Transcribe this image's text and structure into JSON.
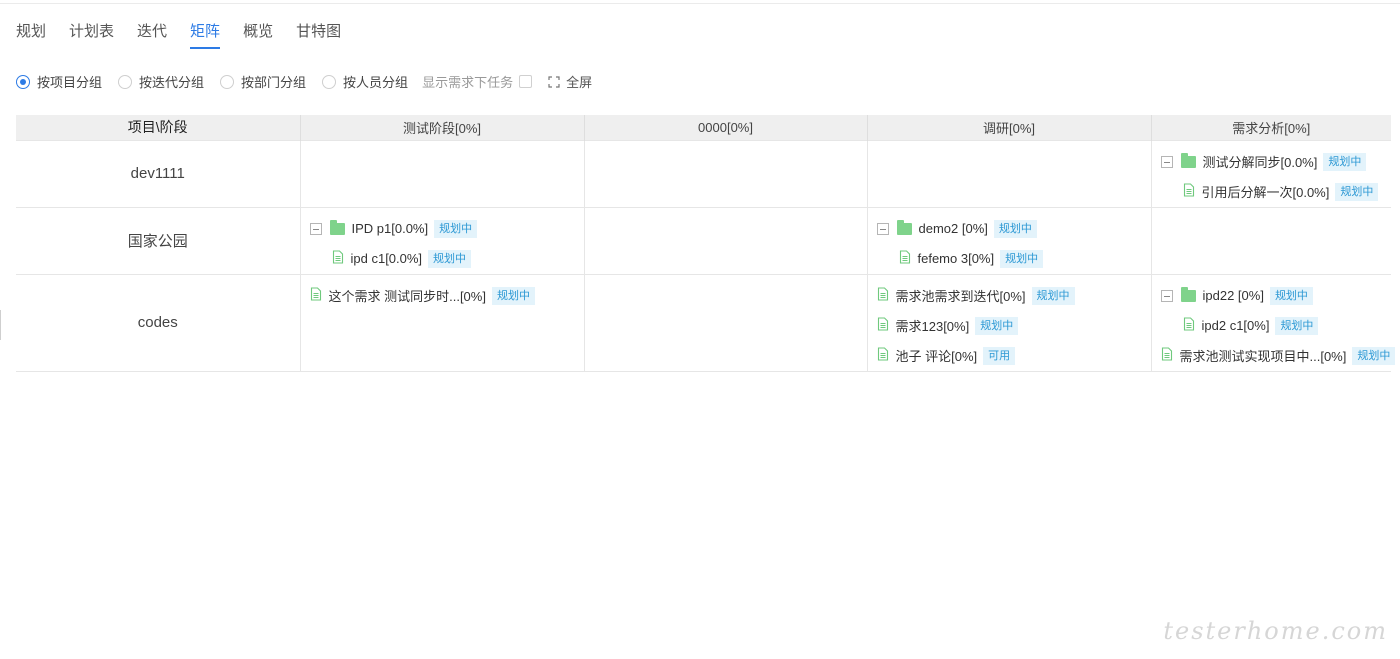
{
  "tabs": [
    {
      "label": "规划",
      "active": false
    },
    {
      "label": "计划表",
      "active": false
    },
    {
      "label": "迭代",
      "active": false
    },
    {
      "label": "矩阵",
      "active": true
    },
    {
      "label": "概览",
      "active": false
    },
    {
      "label": "甘特图",
      "active": false
    }
  ],
  "toolbar": {
    "group_options": [
      {
        "label": "按项目分组",
        "checked": true
      },
      {
        "label": "按迭代分组",
        "checked": false
      },
      {
        "label": "按部门分组",
        "checked": false
      },
      {
        "label": "按人员分组",
        "checked": false
      }
    ],
    "show_subtasks_label": "显示需求下任务",
    "fullscreen_label": "全屏"
  },
  "matrix": {
    "columns": [
      "项目\\阶段",
      "测试阶段[0%]",
      "0000[0%]",
      "调研[0%]",
      "需求分析[0%]"
    ],
    "rows": [
      {
        "name": "dev1111",
        "cells": [
          [],
          [],
          [],
          [
            {
              "kind": "folder",
              "text": "测试分解同步[0.0%]",
              "badge": "规划中"
            },
            {
              "kind": "doc",
              "child": true,
              "text": "引用后分解一次[0.0%]",
              "badge": "规划中"
            }
          ]
        ]
      },
      {
        "name": "国家公园",
        "cells": [
          [
            {
              "kind": "folder",
              "text": "IPD p1[0.0%]",
              "badge": "规划中"
            },
            {
              "kind": "doc",
              "child": true,
              "text": "ipd c1[0.0%]",
              "badge": "规划中"
            }
          ],
          [],
          [
            {
              "kind": "folder",
              "text": "demo2 [0%]",
              "badge": "规划中"
            },
            {
              "kind": "doc",
              "child": true,
              "text": "fefemo 3[0%]",
              "badge": "规划中"
            }
          ],
          []
        ]
      },
      {
        "name": "codes",
        "cells": [
          [
            {
              "kind": "doc",
              "text": "这个需求 测试同步时...[0%]",
              "badge": "规划中"
            }
          ],
          [],
          [
            {
              "kind": "doc",
              "text": "需求池需求到迭代[0%]",
              "badge": "规划中"
            },
            {
              "kind": "doc",
              "text": "需求123[0%]",
              "badge": "规划中"
            },
            {
              "kind": "doc",
              "text": "池子 评论[0%]",
              "badge": "可用"
            }
          ],
          [
            {
              "kind": "folder",
              "text": "ipd22 [0%]",
              "badge": "规划中"
            },
            {
              "kind": "doc",
              "child": true,
              "text": "ipd2 c1[0%]",
              "badge": "规划中"
            },
            {
              "kind": "doc",
              "text": "需求池测试实现项目中...[0%]",
              "badge": "规划中"
            }
          ]
        ]
      }
    ]
  },
  "watermark": "testerhome.com"
}
